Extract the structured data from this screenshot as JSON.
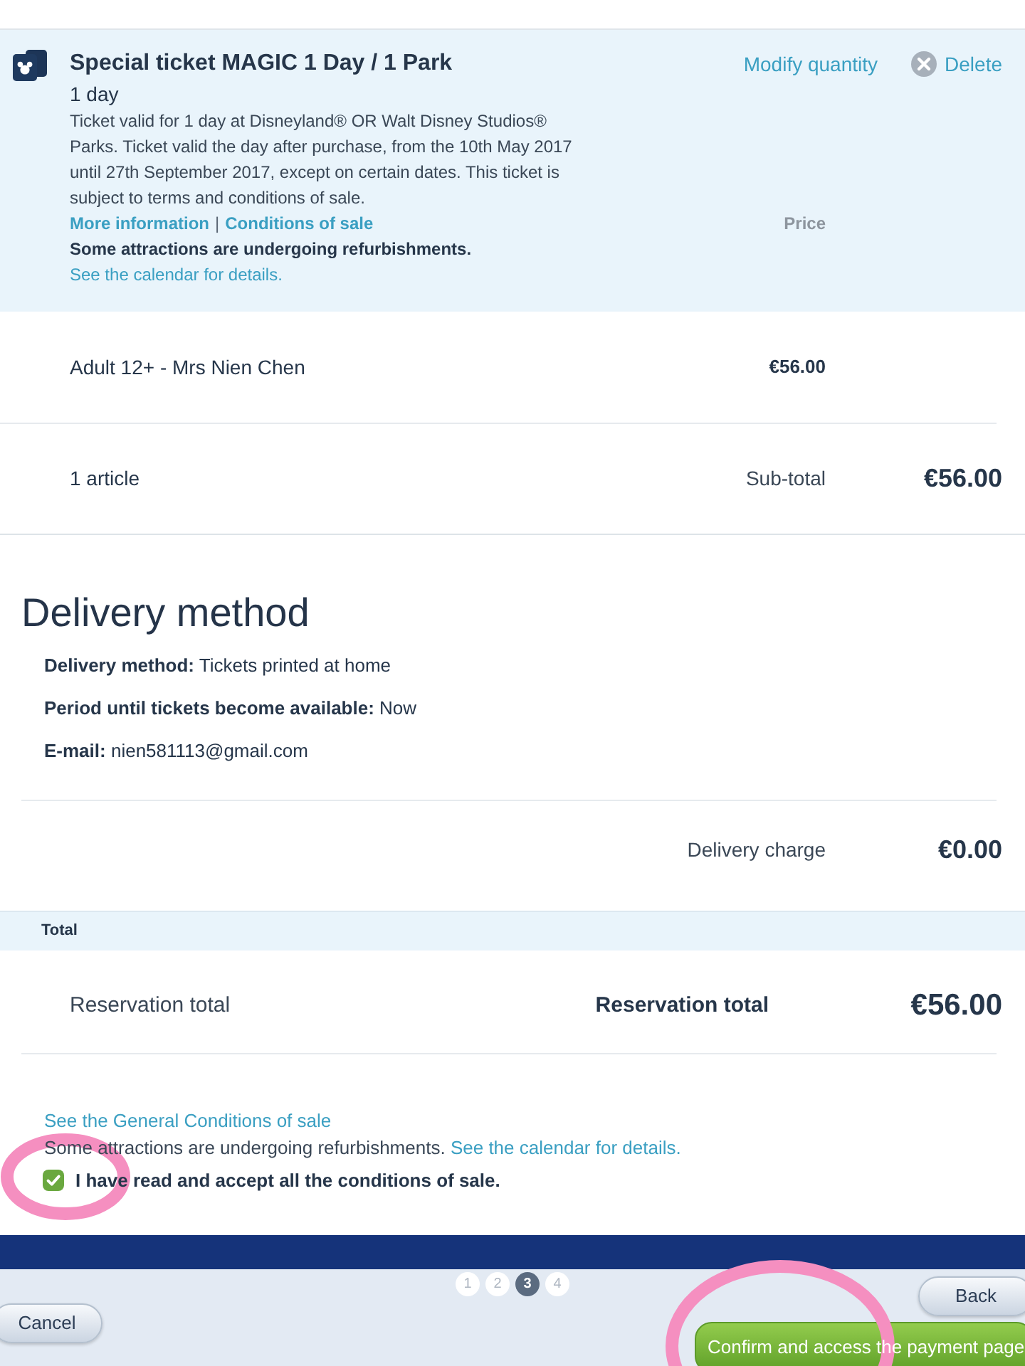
{
  "ticket": {
    "title": "Special ticket MAGIC 1 Day / 1 Park",
    "duration": "1 day",
    "description": "Ticket valid for 1 day at Disneyland® OR Walt Disney Studios® Parks. Ticket valid the day after purchase, from the 10th May 2017 until 27th September 2017, except on certain dates. This ticket is subject to terms and conditions of sale.",
    "links": [
      "More information",
      "Conditions of sale"
    ],
    "link_separator": "|",
    "notice": "Some attractions are undergoing refurbishments.",
    "notice_link": "See the calendar for details.",
    "actions": {
      "modify": "Modify quantity",
      "delete": "Delete"
    },
    "price_header": "Price"
  },
  "items": [
    {
      "label": "Adult 12+ - Mrs Nien Chen",
      "price": "€56.00"
    }
  ],
  "subtotal": {
    "count": "1 article",
    "label": "Sub-total",
    "amount": "€56.00"
  },
  "delivery": {
    "heading": "Delivery method",
    "details": [
      {
        "label": "Delivery method:",
        "value": "Tickets printed at home"
      },
      {
        "label": "Period until tickets become available:",
        "value": "Now"
      },
      {
        "label": "E-mail:",
        "value": "nien581113@gmail.com"
      }
    ],
    "charge_label": "Delivery charge",
    "charge": "€0.00"
  },
  "total": {
    "band_label": "Total",
    "label": "Reservation total",
    "summary_label": "Reservation total",
    "amount": "€56.00"
  },
  "conditions": {
    "link": "See the General Conditions of sale",
    "notice": "Some attractions are undergoing refurbishments.",
    "notice_link": "See the calendar for details.",
    "accept": {
      "label": "I have read and accept all the conditions of sale.",
      "checked": true
    }
  },
  "steps": [
    {
      "label": "1",
      "selected": false
    },
    {
      "label": "2",
      "selected": false
    },
    {
      "label": "3",
      "selected": true
    },
    {
      "label": "4",
      "selected": false
    }
  ],
  "buttons": {
    "cancel": "Cancel",
    "back": "Back",
    "confirm": "Confirm and access the payment page"
  }
}
